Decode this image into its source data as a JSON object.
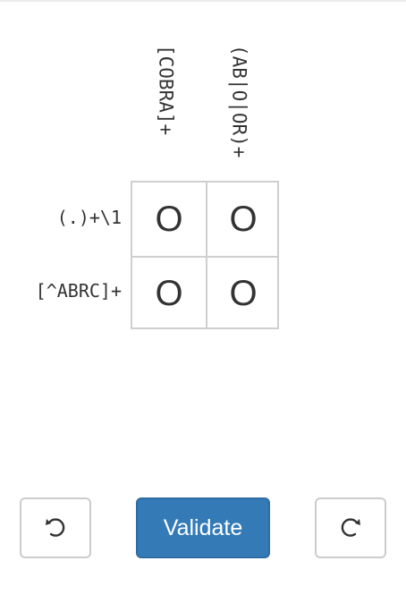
{
  "puzzle": {
    "column_clues": [
      "[COBRA]+",
      "(AB|O|OR)+"
    ],
    "row_clues": [
      "(.)+\\1",
      "[^ABRC]+"
    ],
    "cells": [
      [
        "O",
        "O"
      ],
      [
        "O",
        "O"
      ]
    ]
  },
  "controls": {
    "undo_icon": "undo-icon",
    "validate_label": "Validate",
    "redo_icon": "redo-icon",
    "accent_color": "#337ab7"
  }
}
